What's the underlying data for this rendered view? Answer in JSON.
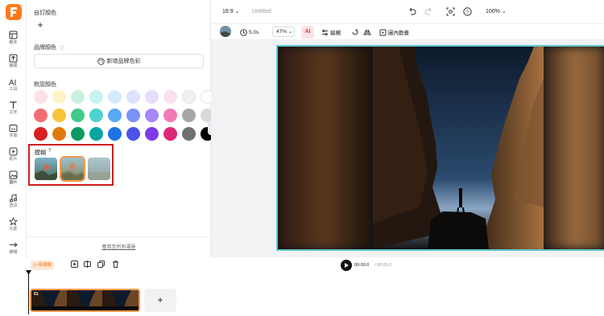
{
  "sidebar": {
    "items": [
      {
        "label": "範本",
        "icon": "template-icon"
      },
      {
        "label": "擴展",
        "icon": "upload-icon"
      },
      {
        "label": "工具",
        "icon": "ai-tools-icon"
      },
      {
        "label": "文字",
        "icon": "text-icon"
      },
      {
        "label": "字幕",
        "icon": "subtitle-icon"
      },
      {
        "label": "影片",
        "icon": "video-icon"
      },
      {
        "label": "圖片",
        "icon": "image-icon"
      },
      {
        "label": "音訊",
        "icon": "audio-icon"
      },
      {
        "label": "元素",
        "icon": "elements-icon"
      },
      {
        "label": "轉場",
        "icon": "transition-icon"
      },
      {
        "label": "品牌",
        "icon": "brand-icon"
      }
    ]
  },
  "panel": {
    "custom_color_title": "自訂顏色",
    "add_custom": "+",
    "brand_color_title": "品牌顏色",
    "brand_tip": "ⓘ",
    "add_brand_color": "新增品牌色彩",
    "default_color_title": "默認顏色",
    "blur_title": "模糊",
    "blur_help": "?",
    "apply_all": "應用至所有場景",
    "swatch_rows": [
      [
        "#fde1e4",
        "#fdf3c6",
        "#c9f1df",
        "#c6f2ef",
        "#d4eafc",
        "#dde3fd",
        "#e6dcfd",
        "#fbe0ef",
        "#f1f1f1",
        "#ffffff"
      ],
      [
        "#f16d72",
        "#f9c33a",
        "#41c98e",
        "#4ed2cf",
        "#59a8f5",
        "#7b93f5",
        "#a786f7",
        "#f179b6",
        "#a6a6a6",
        "#d9d9d9"
      ],
      [
        "#d9201f",
        "#e07a0e",
        "#0c9a62",
        "#0aa5a2",
        "#1e74e6",
        "#4b54e8",
        "#7d3be6",
        "#dd2877",
        "#6f6f6f",
        "#000000"
      ]
    ]
  },
  "topbar": {
    "ratio": "16:9",
    "title": "Untitled",
    "zoom": "100%"
  },
  "toolbar": {
    "duration": "5.0s",
    "scale": "47%",
    "ai_label": "AI",
    "edit": "編輯",
    "motion": "圖內動畫"
  },
  "playback": {
    "current": "00:00.0",
    "total": "/ 00:05.0"
  },
  "timeline": {
    "badge": "時間線",
    "clip_number": "01",
    "add": "+"
  },
  "colors": {
    "brand": "#ff7a1a",
    "selection": "#5fc6cf",
    "highlight": "#cf1d1d"
  }
}
